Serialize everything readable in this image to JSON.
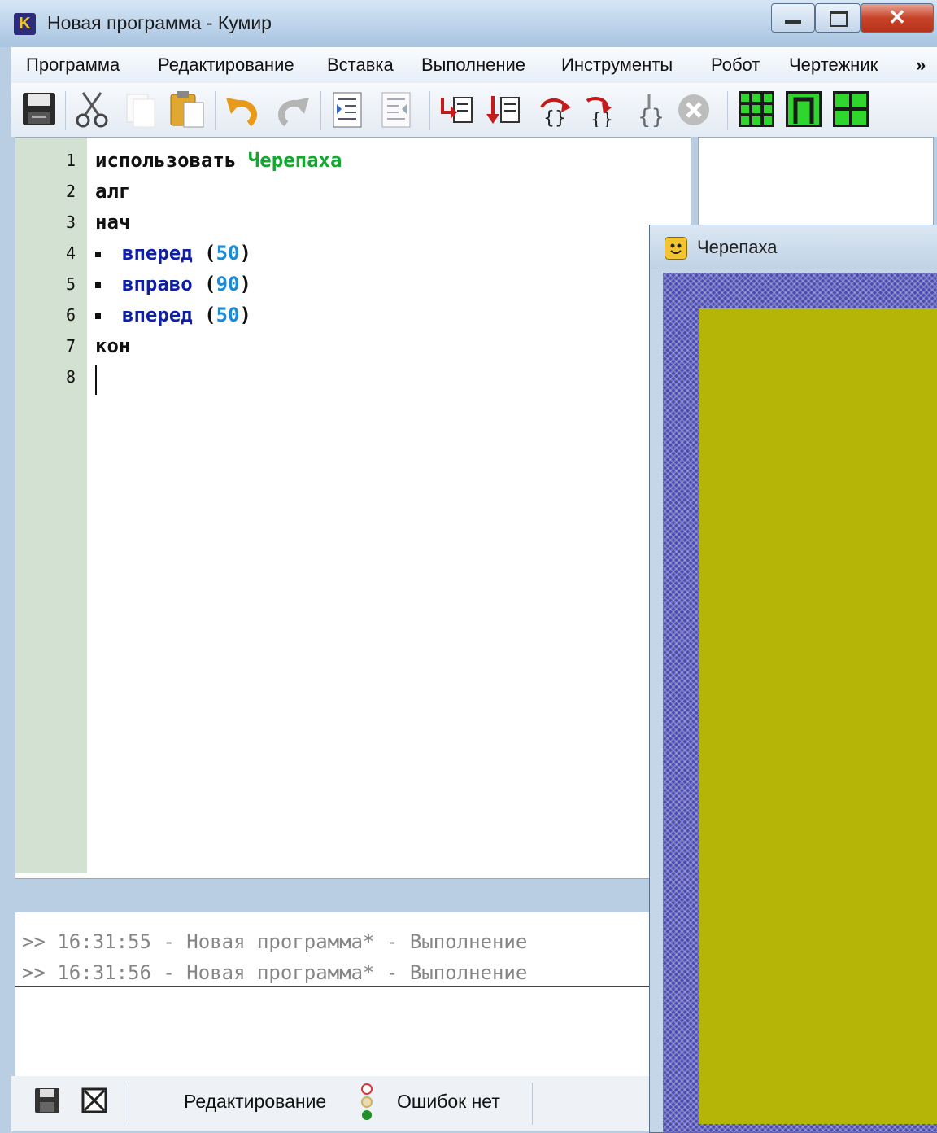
{
  "window": {
    "title": "Новая программа - Кумир",
    "app_icon_letter": "K"
  },
  "menu": [
    "Программа",
    "Редактирование",
    "Вставка",
    "Выполнение",
    "Инструменты",
    "Робот",
    "Чертежник",
    "»"
  ],
  "editor": {
    "line_numbers": [
      "1",
      "2",
      "3",
      "4",
      "5",
      "6",
      "7",
      "8"
    ],
    "lines": {
      "l1_kw": "использовать",
      "l1_mod": "Черепаха",
      "l2": "алг",
      "l3": "нач",
      "l4_cmd": "вперед",
      "l4_open": " (",
      "l4_num": "50",
      "l4_close": ")",
      "l5_cmd": "вправо",
      "l5_open": " (",
      "l5_num": "90",
      "l5_close": ")",
      "l6_cmd": "вперед",
      "l6_open": " (",
      "l6_num": "50",
      "l6_close": ")",
      "l7": "кон"
    }
  },
  "console": {
    "lines": [
      ">> 16:31:55 - Новая программа* - Выполнение",
      ">> 16:31:56 - Новая программа* - Выполнение"
    ]
  },
  "status": {
    "mode": "Редактирование",
    "errors": "Ошибок нет"
  },
  "turtle_window": {
    "title": "Черепаха",
    "field_color": "#b5b508",
    "border_color": "#4a4ab0"
  },
  "colors": {
    "keyword": "#0d1ea8",
    "module": "#13a82f",
    "number": "#1b8ad8",
    "gutter": "#d3e1d2"
  }
}
